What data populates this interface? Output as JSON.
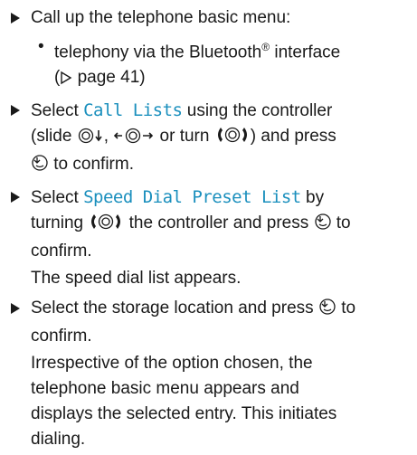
{
  "steps": [
    {
      "text": "Call up the telephone basic menu:",
      "sub": [
        {
          "l1": "telephony via the Bluetooth",
          "reg": "®",
          "l2": " interface",
          "l3a": "(",
          "l3b": " page 41)"
        }
      ]
    },
    {
      "t1": "Select ",
      "hl": "Call Lists",
      "t2": " using the controller",
      "t3": "(slide ",
      "t4": ", ",
      "t5": " or turn ",
      "t6": ") and press",
      "t7": " to confirm."
    },
    {
      "t1": "Select ",
      "hl": "Speed Dial Preset List",
      "t2": " by",
      "t3": "turning ",
      "t4": " the controller and press ",
      "t5": " to",
      "t6": "confirm.",
      "result": "The speed dial list appears."
    },
    {
      "t1": "Select the storage location and press ",
      "t2": " to",
      "t3": "confirm.",
      "r1": "Irrespective of the option chosen, the",
      "r2": "telephone basic menu appears and",
      "r3": "displays the selected entry. This initiates",
      "r4": "dialing."
    }
  ],
  "colors": {
    "text": "#1a1a1a",
    "highlight": "#1a8fbd"
  },
  "icons": [
    "bullet-triangle-icon",
    "page-reference-icon",
    "controller-slide-down-icon",
    "controller-slide-left-right-icon",
    "controller-turn-icon",
    "controller-press-icon"
  ]
}
